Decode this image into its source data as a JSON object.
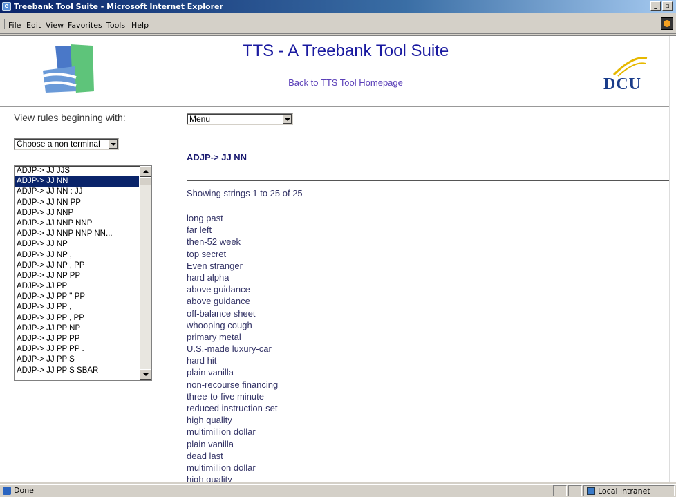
{
  "window": {
    "title": "Treebank Tool Suite - Microsoft Internet Explorer"
  },
  "menubar": {
    "items": [
      "File",
      "Edit",
      "View",
      "Favorites",
      "Tools",
      "Help"
    ]
  },
  "page": {
    "title": "TTS - A Treebank Tool Suite",
    "back_link": "Back to TTS Tool Homepage",
    "dcu_logo_text": "DCU",
    "view_label": "View rules beginning with:",
    "nonterminal_select": "Choose a non terminal",
    "menu_select": "Menu",
    "rule_list": [
      "ADJP-> JJ JJS",
      "ADJP-> JJ NN",
      "ADJP-> JJ NN : JJ",
      "ADJP-> JJ NN PP",
      "ADJP-> JJ NNP",
      "ADJP-> JJ NNP NNP",
      "ADJP-> JJ NNP NNP NN...",
      "ADJP-> JJ NP",
      "ADJP-> JJ NP ,",
      "ADJP-> JJ NP , PP",
      "ADJP-> JJ NP PP",
      "ADJP-> JJ PP",
      "ADJP-> JJ PP '' PP",
      "ADJP-> JJ PP ,",
      "ADJP-> JJ PP , PP",
      "ADJP-> JJ PP NP",
      "ADJP-> JJ PP PP",
      "ADJP-> JJ PP PP .",
      "ADJP-> JJ PP S",
      "ADJP-> JJ PP S SBAR"
    ],
    "selected_rule_index": 1,
    "rule_heading": "ADJP-> JJ NN",
    "showing": "Showing strings 1 to 25 of 25",
    "strings": [
      "long past",
      "far left",
      "then-52 week",
      "top secret",
      "Even stranger",
      "hard alpha",
      "above guidance",
      "above guidance",
      "off-balance sheet",
      "whooping cough",
      "primary metal",
      "U.S.-made luxury-car",
      "hard hit",
      "plain vanilla",
      "non-recourse financing",
      "three-to-five minute",
      "reduced instruction-set",
      "high quality",
      "multimillion dollar",
      "plain vanilla",
      "dead last",
      "multimillion dollar",
      "high quality"
    ]
  },
  "status": {
    "left": "Done",
    "zone": "Local intranet"
  }
}
